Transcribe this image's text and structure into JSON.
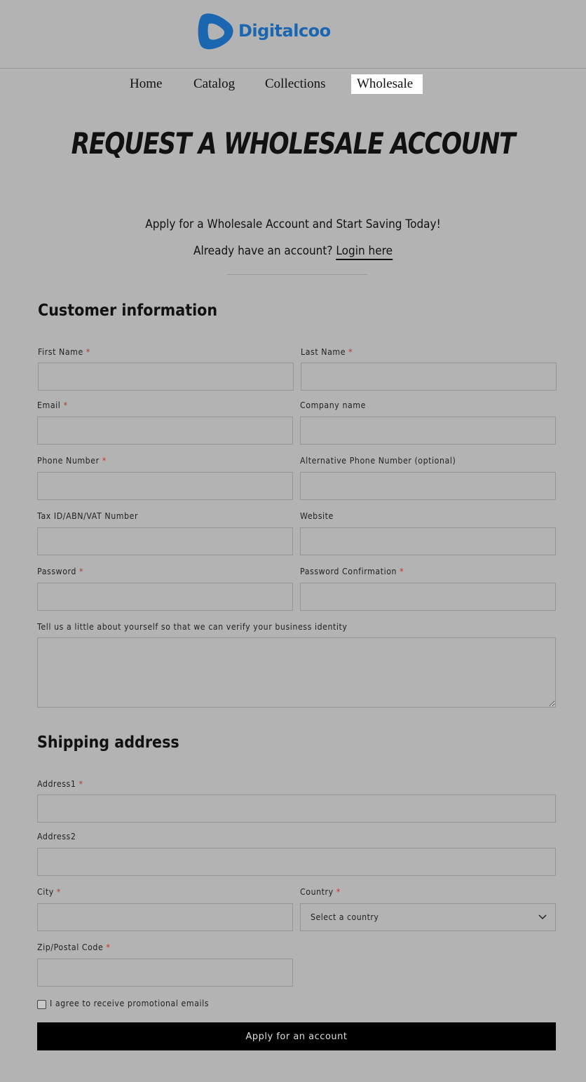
{
  "brand": {
    "name": "Digitalcoo",
    "color": "#1b66b0",
    "logo_icon": "play-shape-logo-icon"
  },
  "nav": {
    "items": [
      {
        "label": "Home",
        "active": false
      },
      {
        "label": "Catalog",
        "active": false
      },
      {
        "label": "Collections",
        "active": false
      },
      {
        "label": "Wholesale",
        "active": true
      }
    ]
  },
  "page": {
    "title": "REQUEST A WHOLESALE ACCOUNT",
    "intro": "Apply for a Wholesale Account and Start Saving Today!",
    "already_text": "Already have an account?",
    "login_link": "Login here"
  },
  "customer": {
    "section_title": "Customer information",
    "required_mark": "*",
    "first_name": {
      "label": "First Name",
      "value": ""
    },
    "last_name": {
      "label": "Last Name",
      "value": ""
    },
    "email": {
      "label": "Email",
      "value": ""
    },
    "company": {
      "label": "Company name",
      "value": ""
    },
    "phone": {
      "label": "Phone Number",
      "value": ""
    },
    "alt_phone": {
      "label": "Alternative Phone Number (optional)",
      "value": ""
    },
    "tax_id": {
      "label": "Tax ID/ABN/VAT Number",
      "value": ""
    },
    "website": {
      "label": "Website",
      "value": ""
    },
    "password": {
      "label": "Password",
      "value": ""
    },
    "password_confirm": {
      "label": "Password Confirmation",
      "value": ""
    },
    "about": {
      "label": "Tell us a little about yourself so that we can verify your business identity",
      "value": ""
    }
  },
  "shipping": {
    "section_title": "Shipping address",
    "address1": {
      "label": "Address1",
      "value": ""
    },
    "address2": {
      "label": "Address2",
      "value": ""
    },
    "city": {
      "label": "City",
      "value": ""
    },
    "country": {
      "label": "Country",
      "selected": "Select a country"
    },
    "zip": {
      "label": "Zip/Postal Code",
      "value": ""
    }
  },
  "consent": {
    "label": "I agree to receive promotional emails",
    "checked": false
  },
  "submit_label": "Apply for an account",
  "colors": {
    "background": "#b3b3b3",
    "required": "#c0392b",
    "button": "#000000"
  }
}
